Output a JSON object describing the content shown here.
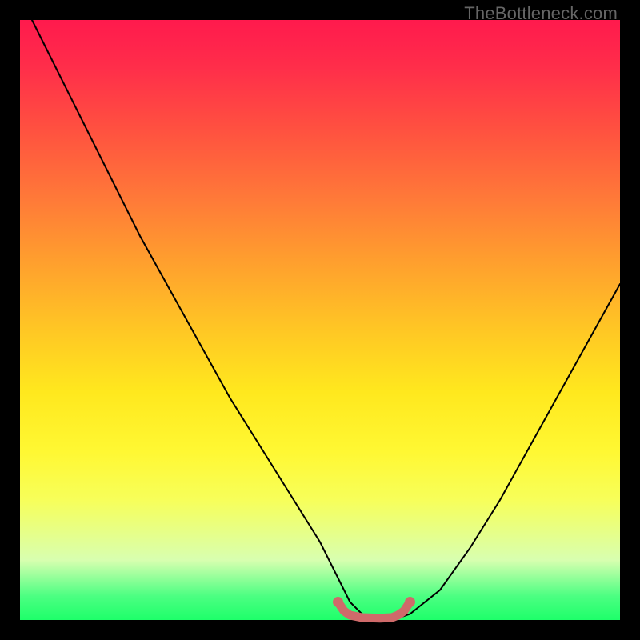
{
  "watermark": "TheBottleneck.com",
  "chart_data": {
    "type": "line",
    "title": "",
    "xlabel": "",
    "ylabel": "",
    "xlim": [
      0,
      100
    ],
    "ylim": [
      0,
      100
    ],
    "grid": false,
    "series": [
      {
        "name": "bottleneck-curve",
        "x": [
          2,
          5,
          10,
          15,
          20,
          25,
          30,
          35,
          40,
          45,
          50,
          53,
          55,
          57,
          60,
          62,
          65,
          70,
          75,
          80,
          85,
          90,
          95,
          100
        ],
        "y": [
          100,
          94,
          84,
          74,
          64,
          55,
          46,
          37,
          29,
          21,
          13,
          7,
          3,
          1,
          0,
          0,
          1,
          5,
          12,
          20,
          29,
          38,
          47,
          56
        ]
      },
      {
        "name": "range-marker",
        "x": [
          53,
          54,
          55,
          57,
          60,
          62,
          63,
          64,
          65
        ],
        "y": [
          3,
          1.5,
          0.8,
          0.4,
          0.3,
          0.4,
          0.8,
          1.5,
          3
        ]
      }
    ],
    "colors": {
      "curve": "#000000",
      "marker": "#cf6a6a"
    },
    "annotation": "V-shaped bottleneck curve over green-to-red gradient; minimum lies roughly between x≈53 and x≈65."
  }
}
